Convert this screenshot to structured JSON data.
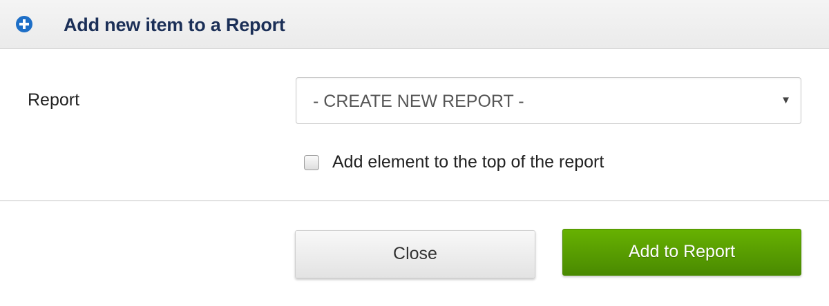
{
  "dialog": {
    "title": "Add new item to a Report",
    "title_icon": "plus-circle-icon",
    "title_color": "#1b2f57",
    "icon_color": "#1e6fc7"
  },
  "form": {
    "report_label": "Report",
    "report_select": {
      "selected_value": "- CREATE NEW REPORT -",
      "arrow_icon": "dropdown-triangle-icon"
    },
    "top_checkbox": {
      "label": "Add element to the top of the report",
      "checked": false
    }
  },
  "footer": {
    "close_label": "Close",
    "add_label": "Add to Report",
    "add_button_color": "#5a9e01"
  }
}
